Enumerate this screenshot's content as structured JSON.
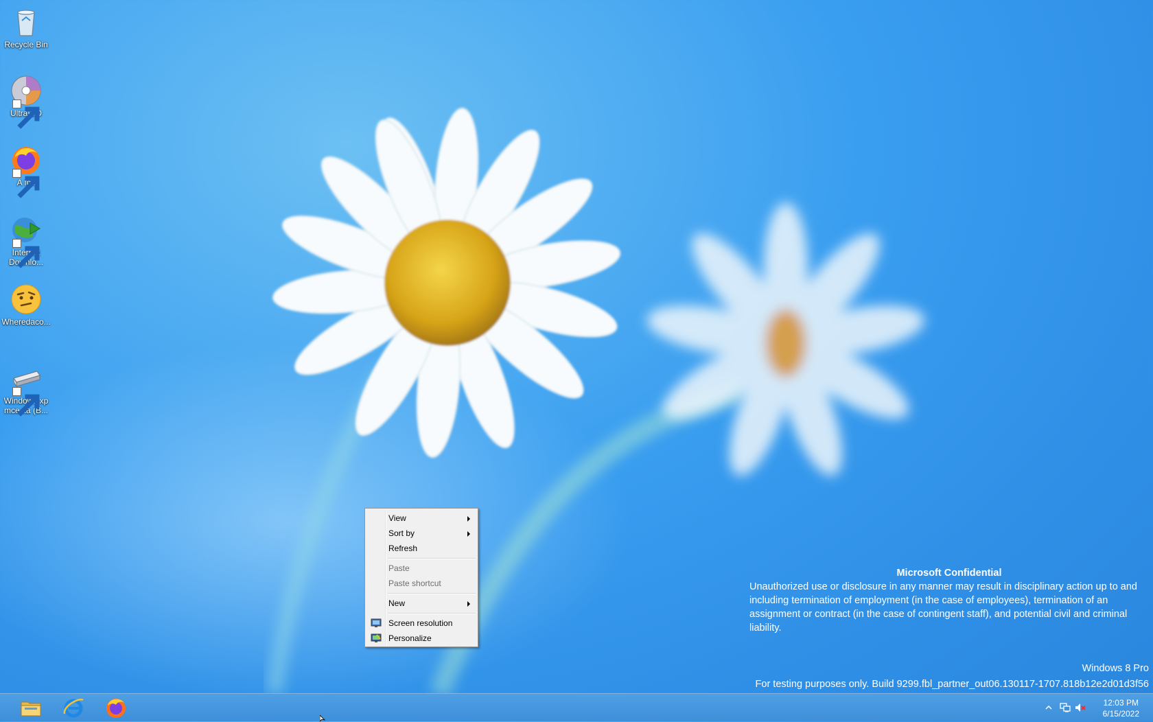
{
  "desktop": {
    "icons": [
      {
        "label": "Recycle Bin",
        "icon": "recycle-bin-icon"
      },
      {
        "label": "UltraISO",
        "icon": "ultraiso-disc-icon"
      },
      {
        "label": "A fox",
        "icon": "firefox-icon"
      },
      {
        "label": "Internet Downlo...",
        "icon": "internet-download-manager-icon"
      },
      {
        "label": "Wheredaco...",
        "icon": "thinking-face-icon"
      },
      {
        "label": "Windows xp mce ita (B...",
        "icon": "drive-icon"
      }
    ]
  },
  "context_menu": {
    "items": [
      {
        "label": "View",
        "submenu": true,
        "enabled": true
      },
      {
        "label": "Sort by",
        "submenu": true,
        "enabled": true
      },
      {
        "label": "Refresh",
        "enabled": true
      },
      {
        "label": "Paste",
        "enabled": false
      },
      {
        "label": "Paste shortcut",
        "enabled": false
      },
      {
        "label": "New",
        "submenu": true,
        "enabled": true
      },
      {
        "label": "Screen resolution",
        "icon": "display-icon",
        "enabled": true
      },
      {
        "label": "Personalize",
        "icon": "personalize-icon",
        "enabled": true
      }
    ]
  },
  "watermark": {
    "title": "Microsoft Confidential",
    "body": "Unauthorized use or disclosure in any manner may result in disciplinary action up to and including termination of employment (in the case of employees), termination of an assignment or contract (in the case of contingent staff), and potential civil and criminal liability.",
    "edition": "Windows 8 Pro",
    "build": "For testing purposes only. Build 9299.fbl_partner_out06.130117-1707.818b12e2d01d3f56"
  },
  "taskbar": {
    "pinned": [
      "file-explorer-icon",
      "internet-explorer-icon",
      "firefox-icon"
    ],
    "tray": [
      "show-hidden-icons-icon",
      "network-icon",
      "volume-muted-icon"
    ],
    "time": "12:03 PM",
    "date": "6/15/2022"
  },
  "colors": {
    "sky": "#3a9ef0",
    "taskbar": "#3d8fd9",
    "menu_bg": "#f0f0f0"
  }
}
